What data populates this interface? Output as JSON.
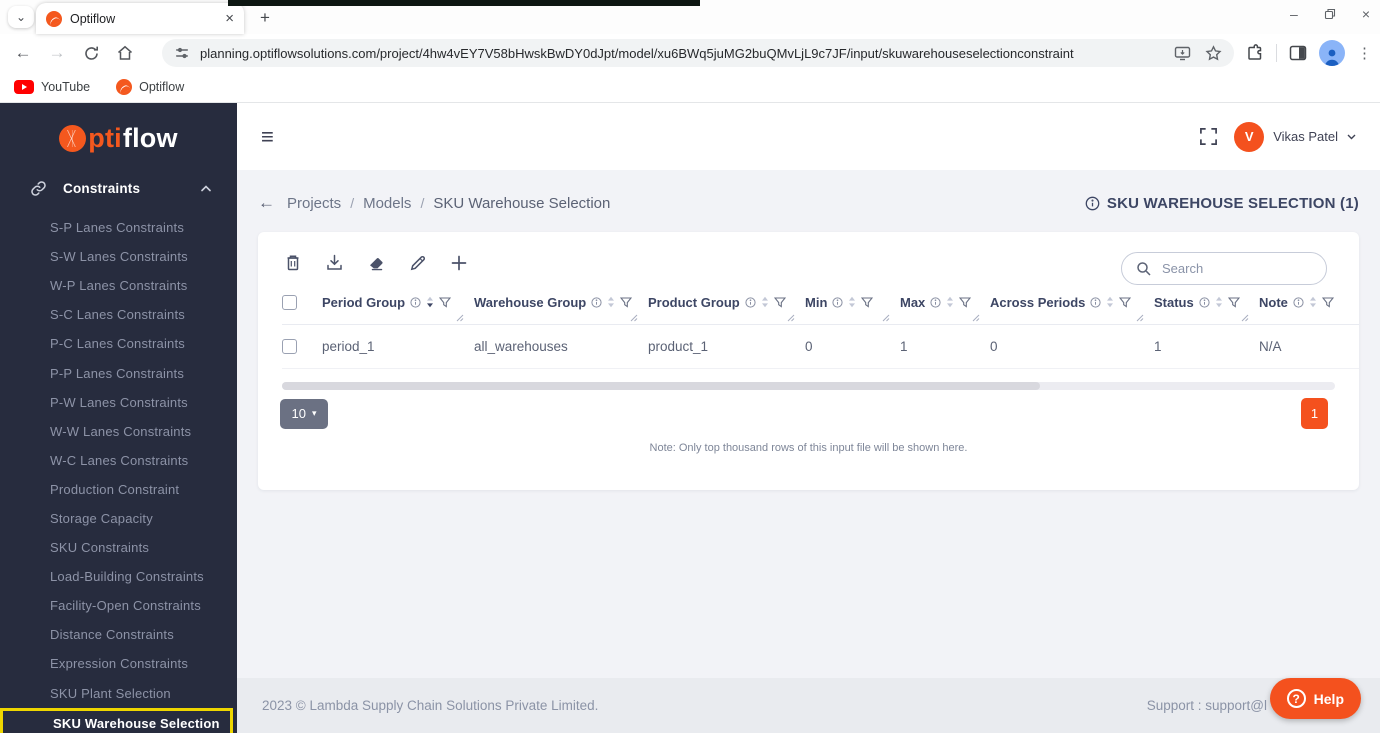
{
  "browser": {
    "tab_title": "Optiflow",
    "url": "planning.optiflowsolutions.com/project/4hw4vEY7V58bHwskBwDY0dJpt/model/xu6BWq5juMG2buQMvLjL9c7JF/input/skuwarehouseselectionconstraint",
    "bookmarks": [
      "YouTube",
      "Optiflow"
    ]
  },
  "icons": {
    "tab_chevron": "⌄",
    "tab_close": "×",
    "new_tab": "+",
    "minimize": "–",
    "window_close": "×",
    "back_arrow": "←",
    "forward_arrow": "→",
    "dots": "⋮",
    "hamburger": "≡",
    "caret_down": "▾",
    "breadcrumb_back": "←",
    "help_question": "?"
  },
  "sidebar": {
    "logo": {
      "pti": "pti",
      "flow": "flow"
    },
    "section_label": "Constraints",
    "items": [
      "S-P Lanes Constraints",
      "S-W Lanes Constraints",
      "W-P Lanes Constraints",
      "S-C Lanes Constraints",
      "P-C Lanes Constraints",
      "P-P Lanes Constraints",
      "P-W Lanes Constraints",
      "W-W Lanes Constraints",
      "W-C Lanes Constraints",
      "Production Constraint",
      "Storage Capacity",
      "SKU Constraints",
      "Load-Building Constraints",
      "Facility-Open Constraints",
      "Distance Constraints",
      "Expression Constraints",
      "SKU Plant Selection"
    ],
    "active_item": "SKU Warehouse Selection"
  },
  "topbar": {
    "user_initial": "V",
    "user_name": "Vikas Patel"
  },
  "breadcrumb": {
    "separator": "/",
    "items": [
      "Projects",
      "Models",
      "SKU Warehouse Selection"
    ]
  },
  "page": {
    "title": "SKU WAREHOUSE SELECTION (1)"
  },
  "card": {
    "search_placeholder": "Search",
    "table": {
      "columns": [
        "Period Group",
        "Warehouse Group",
        "Product Group",
        "Min",
        "Max",
        "Across Periods",
        "Status",
        "Note"
      ],
      "rows": [
        [
          "period_1",
          "all_warehouses",
          "product_1",
          "0",
          "1",
          "0",
          "1",
          "N/A"
        ]
      ]
    },
    "page_size": "10",
    "page_number": "1",
    "note": "Note: Only top thousand rows of this input file will be shown here."
  },
  "footer": {
    "copyright": "2023 © Lambda Supply Chain Solutions Private Limited.",
    "support": "Support : support@l",
    "help_label": "Help"
  }
}
